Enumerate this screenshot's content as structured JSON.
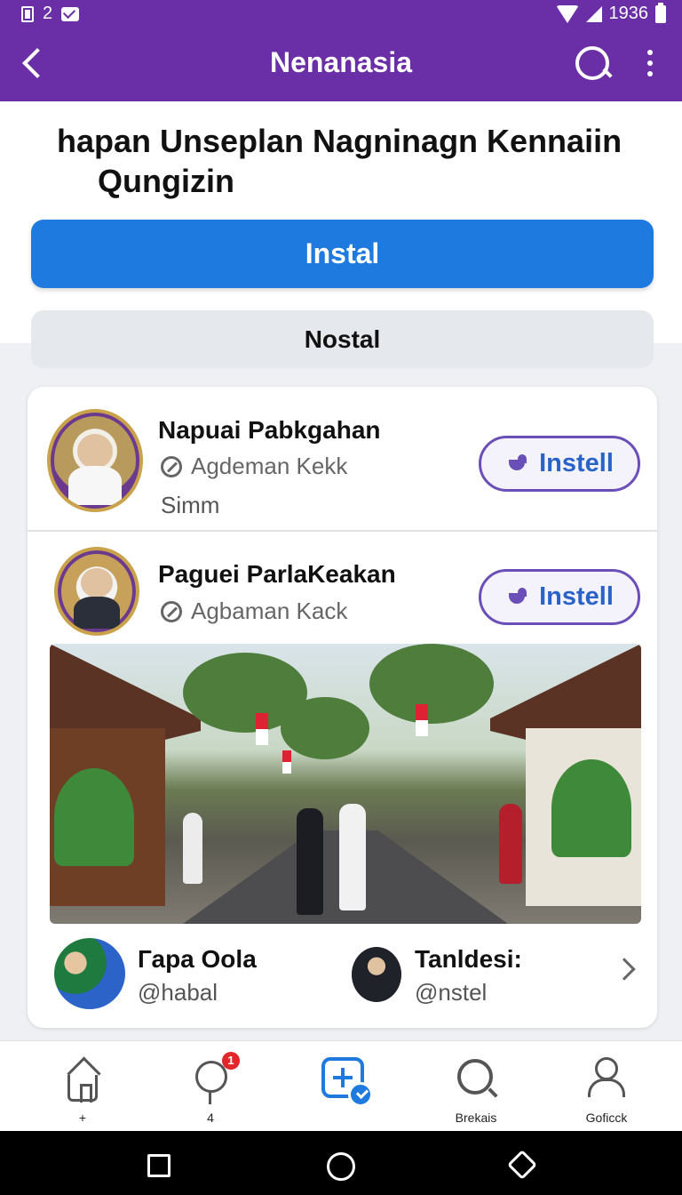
{
  "status_bar": {
    "left_text": "2",
    "right_text": "1936"
  },
  "app_bar": {
    "title": "Nenanasia"
  },
  "header": {
    "title_line1": "hapan Unseplan Nagninagn Kennaiin",
    "title_line2": "Qungizin",
    "primary_button": "Instal",
    "secondary_button": "Nostal"
  },
  "card": {
    "items": [
      {
        "name": "Napuai Pabkgahan",
        "subtitle": "Agdeman Kekk",
        "extra": "Simm",
        "button": "Instell",
        "button_icon": "bird-icon"
      },
      {
        "name": "Paguei ParlaKeakan",
        "subtitle": "Agbaman Kack",
        "button": "Instell",
        "button_icon": "bird-icon"
      }
    ],
    "users": [
      {
        "name": "Гара Oola",
        "handle": "@habal"
      },
      {
        "name": "Tanldesi:",
        "handle": "@nstel"
      }
    ]
  },
  "bottom_nav": {
    "items": [
      {
        "label": "+",
        "icon": "home-icon"
      },
      {
        "label": "4",
        "icon": "chat-icon",
        "badge": "1"
      },
      {
        "label": "",
        "icon": "add-post-icon"
      },
      {
        "label": "Brekais",
        "icon": "search-icon"
      },
      {
        "label": "Goficck",
        "icon": "profile-icon"
      }
    ]
  },
  "colors": {
    "accent": "#6a2fa6",
    "primary": "#1f7ae0",
    "badge": "#e3262a"
  }
}
